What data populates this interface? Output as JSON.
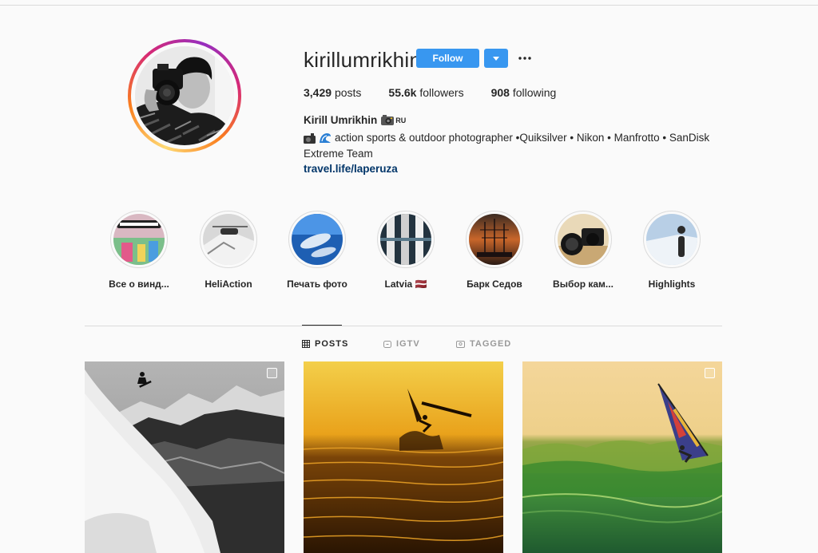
{
  "profile": {
    "username": "kirillumrikhin",
    "follow_label": "Follow",
    "more_icon": "more-horizontal-icon",
    "stats": {
      "posts_count": "3,429",
      "posts_label": "posts",
      "followers_count": "55.6k",
      "followers_label": "followers",
      "following_count": "908",
      "following_label": "following"
    },
    "full_name": "Kirill Umrikhin",
    "country_badge": "RU",
    "bio": "action sports & outdoor photographer •Quiksilver • Nikon • Manfrotto • SanDisk Extreme Team",
    "link": "travel.life/laperuza"
  },
  "highlights": [
    {
      "label": "Все о винд...",
      "icon": "windsurfing-highlight"
    },
    {
      "label": "HeliAction",
      "icon": "heli-highlight"
    },
    {
      "label": "Печать фото",
      "icon": "print-highlight"
    },
    {
      "label": "Latvia 🇱🇻",
      "icon": "latvia-highlight"
    },
    {
      "label": "Барк Седов",
      "icon": "ship-highlight"
    },
    {
      "label": "Выбор кам...",
      "icon": "camera-highlight"
    },
    {
      "label": "Highlights",
      "icon": "snowboard-highlight"
    }
  ],
  "tabs": [
    {
      "label": "POSTS",
      "icon": "grid-icon",
      "active": true
    },
    {
      "label": "IGTV",
      "icon": "igtv-icon",
      "active": false
    },
    {
      "label": "TAGGED",
      "icon": "tagged-icon",
      "active": false
    }
  ],
  "colors": {
    "follow_blue": "#3897f0",
    "link_blue": "#003569",
    "text": "#262626",
    "muted": "#999999"
  },
  "posts": [
    {
      "subject": "snowboard-mountain-bw",
      "multi": true
    },
    {
      "subject": "windsurf-sunset",
      "multi": false
    },
    {
      "subject": "windsurf-wave",
      "multi": true
    }
  ]
}
